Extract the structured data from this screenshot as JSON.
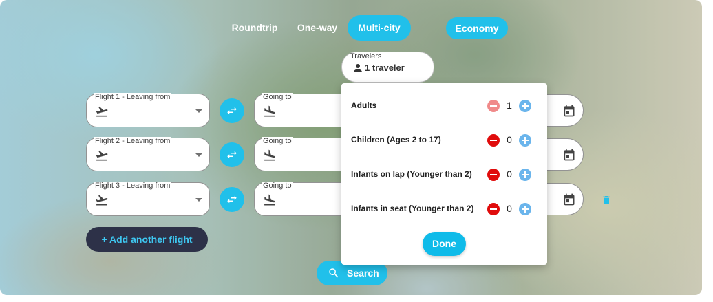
{
  "trip_types": {
    "roundtrip": "Roundtrip",
    "oneway": "One-way",
    "multicity": "Multi-city",
    "selected": "Multi-city"
  },
  "cabin_class": "Economy",
  "travelers": {
    "label": "Travelers",
    "value": "1 traveler"
  },
  "flights": [
    {
      "from_label": "Flight 1 - Leaving from",
      "to_label": "Going to"
    },
    {
      "from_label": "Flight 2 - Leaving from",
      "to_label": "Going to"
    },
    {
      "from_label": "Flight 3 - Leaving from",
      "to_label": "Going to"
    }
  ],
  "add_flight_label": "+ Add another flight",
  "search_label": "Search",
  "passengers": {
    "rows": [
      {
        "label": "Adults",
        "count": "1"
      },
      {
        "label": "Children (Ages 2 to 17)",
        "count": "0"
      },
      {
        "label": "Infants on lap (Younger than 2)",
        "count": "0"
      },
      {
        "label": "Infants in seat (Younger than 2)",
        "count": "0"
      }
    ],
    "done_label": "Done"
  },
  "icons": {
    "departure": "flight-takeoff-icon",
    "arrival": "flight-land-icon",
    "swap": "swap-icon",
    "calendar": "calendar-icon",
    "delete": "trash-icon",
    "person": "person-icon",
    "search": "search-icon"
  },
  "colors": {
    "accent": "#0fbbe9",
    "dark_button": "#1c2039",
    "minus_active": "#e00c0c",
    "minus_disabled": "#f08a8a",
    "plus": "#6bb5ec"
  }
}
